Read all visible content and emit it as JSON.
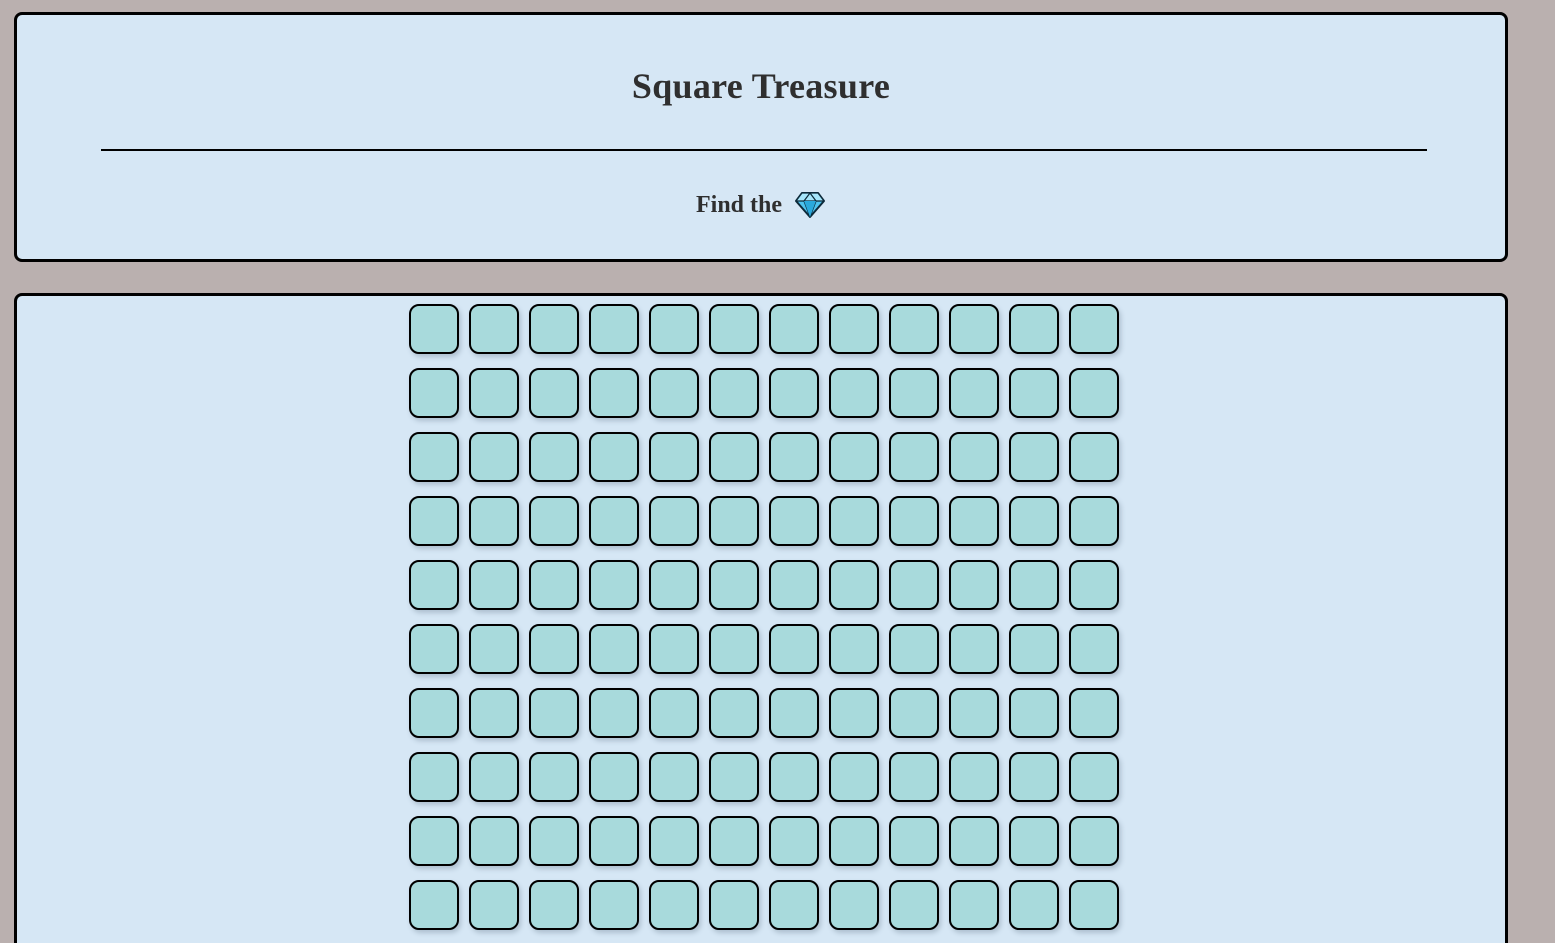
{
  "header": {
    "title": "Square Treasure",
    "instruction": "Find the",
    "target_icon": "gem-icon"
  },
  "board": {
    "rows": 10,
    "columns": 12,
    "tile_state": "hidden"
  },
  "colors": {
    "page_background": "#bab0af",
    "panel_background": "#d6e7f5",
    "tile_fill": "#a8dadc",
    "border": "#000000",
    "text": "#2f2f2f"
  }
}
